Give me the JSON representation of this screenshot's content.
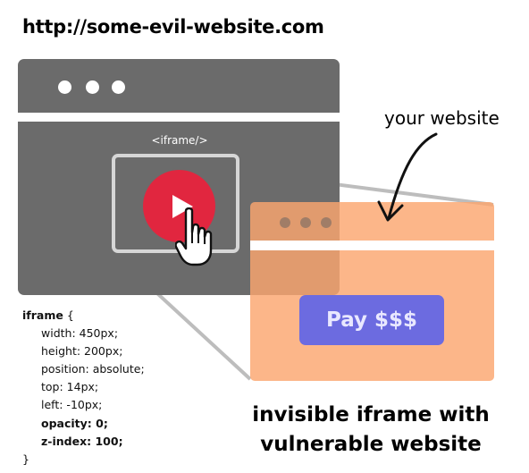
{
  "evil_url": "http://some-evil-website.com",
  "iframe_tag": "<iframe/>",
  "your_website_label": "your website",
  "pay_button": "Pay $$$",
  "code": {
    "selector": "iframe",
    "open_brace": "{",
    "width": "width: 450px;",
    "height": "height: 200px;",
    "position": "position: absolute;",
    "top": "top: 14px;",
    "left": "left: -10px;",
    "opacity": "opacity: 0;",
    "z_index": "z-index: 100;",
    "close_brace": "}"
  },
  "caption_line1": "invisible iframe with",
  "caption_line2": "vulnerable website",
  "colors": {
    "window_gray": "#6b6b6b",
    "play_red": "#e1263f",
    "site_orange": "#fba66f",
    "pay_blue": "#6c6be0"
  }
}
